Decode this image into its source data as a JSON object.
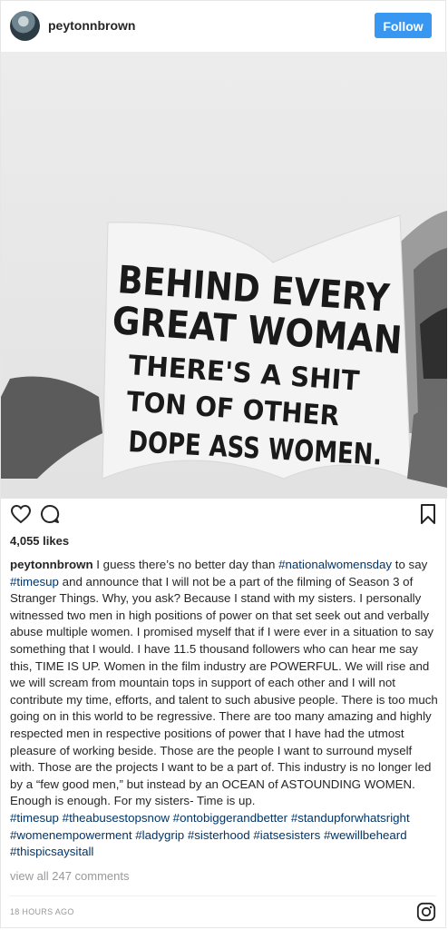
{
  "post": {
    "username": "peytonnbrown",
    "follow_label": "Follow",
    "sign_text": {
      "line1": "BEHIND EVERY",
      "line2": "GREAT WOMAN",
      "line3": "THERE'S A SHIT",
      "line4": "TON OF OTHER",
      "line5": "DOPE ASS WOMEN."
    },
    "likes": "4,055 likes",
    "caption": {
      "username": "peytonnbrown",
      "t1": "I guess there’s no better day than",
      "h1": "#nationalwomensday",
      "t2": "to say",
      "h2": "#timesup",
      "t3": "and announce that I will not be a part of the filming of Season 3 of Stranger Things. Why, you ask? Because I stand with my sisters. I personally witnessed two men in high positions of power on that set seek out and verbally abuse multiple women. I promised myself that if I were ever in a situation to say something that I would. I have 11.5 thousand followers who can hear me say this, TIME IS UP. Women in the film industry are POWERFUL. We will rise and we will scream from mountain tops in support of each other and I will not contribute my time, efforts, and talent to such abusive people. There is too much going on in this world to be regressive. There are too many amazing and highly respected men in respective positions of power that I have had the utmost pleasure of working beside. Those are the people I want to surround myself with. Those are the projects I want to be a part of. This industry is no longer led by a “few good men,” but instead by an OCEAN of ASTOUNDING WOMEN. Enough is enough. For my sisters- Time is up.",
      "hashtags": [
        "#timesup",
        "#theabusestopsnow",
        "#ontobiggerandbetter",
        "#standupforwhatsright",
        "#womenempowerment",
        "#ladygrip",
        "#sisterhood",
        "#iatsesisters",
        "#wewillbeheard",
        "#thispicsaysitall"
      ]
    },
    "comments_link": "view all 247 comments",
    "timestamp": "18 HOURS AGO"
  },
  "colors": {
    "follow_blue": "#3897f0",
    "hashtag": "#003569",
    "muted": "#999999"
  },
  "icons": [
    "heart-icon",
    "comment-icon",
    "bookmark-icon",
    "instagram-icon"
  ]
}
